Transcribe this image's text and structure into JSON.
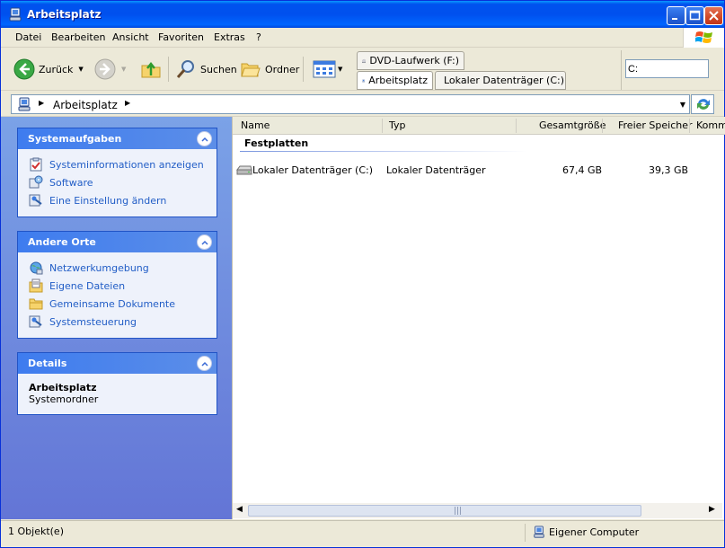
{
  "window": {
    "title": "Arbeitsplatz"
  },
  "menubar": {
    "items": [
      "Datei",
      "Bearbeiten",
      "Ansicht",
      "Favoriten",
      "Extras",
      "?"
    ]
  },
  "toolbar": {
    "back_label": "Zurück",
    "search_label": "Suchen",
    "folders_label": "Ordner",
    "drive_tabs": [
      "DVD-Laufwerk (F:)",
      "Arbeitsplatz",
      "Lokaler Datenträger (C:)"
    ],
    "quick_address_value": "C:"
  },
  "addressbar": {
    "crumb": "Arbeitsplatz"
  },
  "leftpane": {
    "system_tasks": {
      "title": "Systemaufgaben",
      "items": [
        "Systeminformationen anzeigen",
        "Software",
        "Eine Einstellung ändern"
      ]
    },
    "other_places": {
      "title": "Andere Orte",
      "items": [
        "Netzwerkumgebung",
        "Eigene Dateien",
        "Gemeinsame Dokumente",
        "Systemsteuerung"
      ]
    },
    "details": {
      "title": "Details",
      "name": "Arbeitsplatz",
      "type": "Systemordner"
    }
  },
  "list": {
    "columns": [
      "Name",
      "Typ",
      "Gesamtgröße",
      "Freier Speicher",
      "Komm"
    ],
    "group": "Festplatten",
    "rows": [
      {
        "name": "Lokaler Datenträger (C:)",
        "type": "Lokaler Datenträger",
        "total": "67,4 GB",
        "free": "39,3 GB"
      }
    ]
  },
  "statusbar": {
    "count": "1 Objekt(e)",
    "zone": "Eigener Computer"
  },
  "colors": {
    "titlebar": "#0053ee",
    "task_link": "#215dc6",
    "pane_gradient_top": "#7ba2e7"
  }
}
